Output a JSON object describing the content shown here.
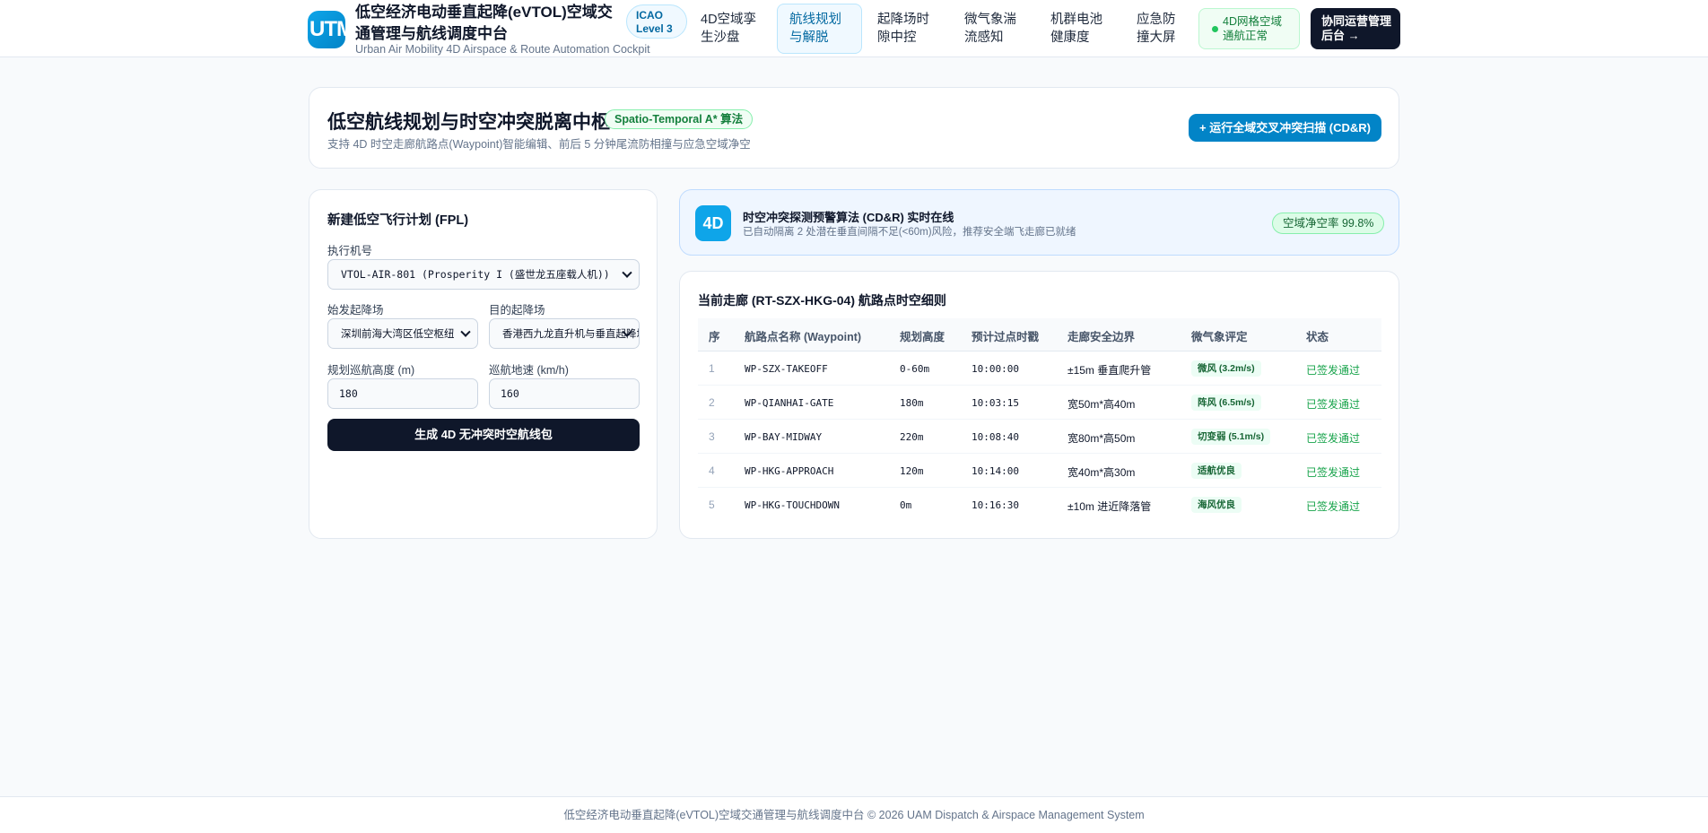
{
  "header": {
    "logo_text": "UTM",
    "title": "低空经济电动垂直起降(eVTOL)空域交通管理与航线调度中台",
    "subtitle": "Urban Air Mobility 4D Airspace & Route Automation Cockpit",
    "icao_badge": {
      "line1": "ICAO",
      "line2": "Level 3"
    },
    "nav": [
      {
        "line1": "4D空域孪",
        "line2": "生沙盘",
        "active": false
      },
      {
        "line1": "航线规划",
        "line2": "与解脱",
        "active": true
      },
      {
        "line1": "起降场时",
        "line2": "隙中控",
        "active": false
      },
      {
        "line1": "微气象湍",
        "line2": "流感知",
        "active": false
      },
      {
        "line1": "机群电池",
        "line2": "健康度",
        "active": false
      },
      {
        "line1": "应急防",
        "line2": "撞大屏",
        "active": false
      }
    ],
    "status": {
      "line1": "4D网格空域",
      "line2": "通航正常",
      "color": "#22c55e"
    },
    "admin_button": {
      "line1": "协同运营管理",
      "line2": "后台 →"
    }
  },
  "hero": {
    "title": "低空航线规划与时空冲突脱离中枢",
    "badge": "Spatio-Temporal A* 算法",
    "description": "支持 4D 时空走廊航路点(Waypoint)智能编辑、前后 5 分钟尾流防相撞与应急空域净空",
    "scan_button": "+ 运行全域交叉冲突扫描 (CD&R)"
  },
  "fpl": {
    "title": "新建低空飞行计划 (FPL)",
    "aircraft_label": "执行机号",
    "aircraft_value": "VTOL-AIR-801 (Prosperity I (盛世龙五座载人机))",
    "origin_label": "始发起降场",
    "origin_value": "深圳前海大湾区低空枢纽",
    "destination_label": "目的起降场",
    "destination_value": "香港西九龙直升机与垂直起降场",
    "altitude_label": "规划巡航高度 (m)",
    "altitude_value": "180",
    "speed_label": "巡航地速 (km/h)",
    "speed_value": "160",
    "generate_button": "生成 4D 无冲突时空航线包"
  },
  "alert": {
    "icon_text": "4D",
    "title": "时空冲突探测预警算法 (CD&R) 实时在线",
    "description": "已自动隔离 2 处潜在垂直间隔不足(<60m)风险，推荐安全端飞走廊已就绪",
    "clear_rate": "空域净空率 99.8%"
  },
  "corridor": {
    "title": "当前走廊 (RT-SZX-HKG-04) 航路点时空细则",
    "columns": [
      "序",
      "航路点名称 (Waypoint)",
      "规划高度",
      "预计过点时戳",
      "走廊安全边界",
      "微气象评定",
      "状态"
    ],
    "rows": [
      {
        "seq": "1",
        "name": "WP-SZX-TAKEOFF",
        "alt": "0-60m",
        "eta": "10:00:00",
        "boundary": "±15m 垂直爬升管",
        "weather": "微风 (3.2m/s)",
        "status": "已签发通过"
      },
      {
        "seq": "2",
        "name": "WP-QIANHAI-GATE",
        "alt": "180m",
        "eta": "10:03:15",
        "boundary": "宽50m*高40m",
        "weather": "阵风 (6.5m/s)",
        "status": "已签发通过"
      },
      {
        "seq": "3",
        "name": "WP-BAY-MIDWAY",
        "alt": "220m",
        "eta": "10:08:40",
        "boundary": "宽80m*高50m",
        "weather": "切变弱 (5.1m/s)",
        "status": "已签发通过"
      },
      {
        "seq": "4",
        "name": "WP-HKG-APPROACH",
        "alt": "120m",
        "eta": "10:14:00",
        "boundary": "宽40m*高30m",
        "weather": "适航优良",
        "status": "已签发通过"
      },
      {
        "seq": "5",
        "name": "WP-HKG-TOUCHDOWN",
        "alt": "0m",
        "eta": "10:16:30",
        "boundary": "±10m 进近降落管",
        "weather": "海风优良",
        "status": "已签发通过"
      }
    ]
  },
  "footer": {
    "text": "低空经济电动垂直起降(eVTOL)空域交通管理与航线调度中台 © 2026 UAM Dispatch & Airspace Management System"
  }
}
